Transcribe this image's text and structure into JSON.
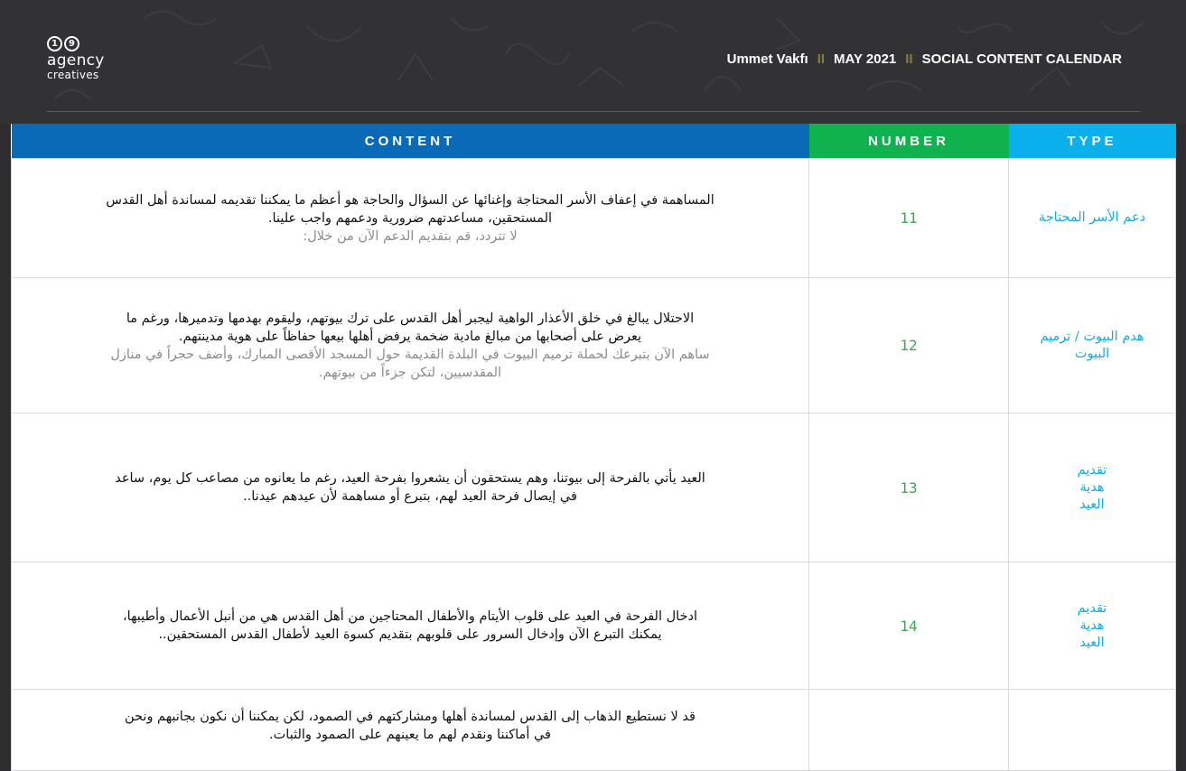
{
  "header": {
    "logo": {
      "digit1": "1",
      "digit2": "9",
      "word1": "agency",
      "word2": "creatives"
    },
    "client": "Ummet Vakfı",
    "separator": "II",
    "month": "MAY 2021",
    "doc_title": "SOCIAL CONTENT CALENDAR"
  },
  "columns": {
    "content": "CONTENT",
    "number": "NUMBER",
    "type": "TYPE"
  },
  "rows": [
    {
      "content_lines": [
        "المساهمة في إعفاف الأسر المحتاجة وإغنائها عن السؤال والحاجة هو أعظم ما يمكننا تقديمه لمساندة أهل القدس",
        "المستحقين، مساعدتهم ضرورية ودعمهم واجب علينا."
      ],
      "sub_lines": [
        "لا تتردد، قم بتقديم الدعم الآن من خلال:"
      ],
      "number": "11",
      "type_lines": [
        "دعم الأسر المحتاجة"
      ]
    },
    {
      "content_lines": [
        "الاحتلال يبالغ في خلق الأعذار الواهية ليجبر أهل   القدس على ترك بيوتهم، وليقوم بهدمها وتدميرها، ورغم ما",
        "يعرض على أصحابها من مبالغ مادية ضخمة يرفض أهلها بيعها حفاظاً على هوية مدينتهم."
      ],
      "sub_lines": [
        "ساهم الآن بتبرعك لحملة ترميم البيوت في البلدة القديمة حول المسجد الأقصى المبارك، وأضف حجراً في منازل",
        "المقدسيين، لتكن جزءاً من بيوتهم."
      ],
      "number": "12",
      "type_lines": [
        "هدم البيوت / ترميم",
        "البيوت"
      ]
    },
    {
      "content_lines": [
        "العيد يأتي بالفرحة إلى بيوتنا، وهم يستحقون أن يشعروا بفرحة العيد، رغم ما يعانوه من مصاعب كل يوم، ساعد",
        "في إيصال فرحة العيد لهم، بتبرع أو مساهمة لأن عيدهم عيدنا.."
      ],
      "sub_lines": [],
      "number": "13",
      "type_lines": [
        "تقديم",
        "هدية",
        "العيد"
      ]
    },
    {
      "content_lines": [
        "ادخال الفرحة في العيد على قلوب الأيتام والأطفال المحتاجين من أهل القدس هي من أنبل الأعمال وأطيبها،",
        "يمكنك التبرع الآن وإدخال السرور على قلوبهم بتقديم كسوة العيد لأطفال القدس المستحقين.."
      ],
      "sub_lines": [],
      "number": "14",
      "type_lines": [
        "تقديم",
        "هدية",
        "العيد"
      ]
    },
    {
      "content_lines": [
        "قد لا نستطيع الذهاب إلى القدس لمساندة أهلها ومشاركتهم في الصمود، لكن يمكننا أن نكون بجانبهم ونحن",
        "في أماكننا ونقدم لهم ما يعينهم على الصمود والثبات."
      ],
      "sub_lines": [],
      "number": "",
      "type_lines": []
    }
  ]
}
